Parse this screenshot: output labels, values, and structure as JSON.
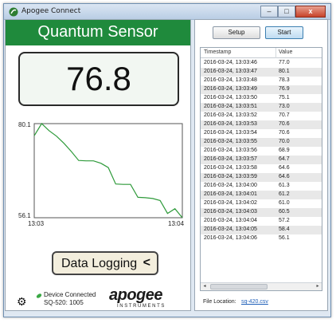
{
  "window": {
    "title": "Apogee Connect",
    "close_glyph": "x",
    "minimize_glyph": "–",
    "maximize_glyph": "□"
  },
  "left": {
    "header_title": "Quantum Sensor",
    "reading": "76.8",
    "data_logging_label": "Data Logging",
    "data_logging_arrow": "<",
    "device_status_line1": "Device Connected",
    "device_status_line2": "SQ-520: 1005",
    "logo_word": "apogee",
    "logo_sub": "INSTRUMENTS",
    "accent_color": "#1f8a3c"
  },
  "chart_data": {
    "type": "line",
    "ytick_labels": [
      "80.1",
      "56.1"
    ],
    "xtick_labels": [
      "13:03",
      "13:04"
    ],
    "ylim": [
      56.1,
      80.1
    ],
    "x": [
      0,
      1,
      2,
      3,
      4,
      5,
      6,
      7,
      8,
      9,
      10,
      11,
      12,
      13,
      14,
      15,
      16,
      17,
      18,
      19,
      20
    ],
    "values": [
      77.0,
      80.1,
      78.3,
      76.9,
      75.1,
      73.0,
      70.7,
      70.6,
      70.6,
      70.0,
      68.9,
      64.7,
      64.6,
      64.6,
      61.3,
      61.2,
      61.0,
      60.5,
      57.2,
      58.4,
      56.1
    ],
    "line_color": "#2e9a3a"
  },
  "right": {
    "setup_label": "Setup",
    "start_label": "Start",
    "columns": [
      "Timestamp",
      "Value"
    ],
    "rows": [
      [
        "2016-03-24, 13:03:46",
        "77.0"
      ],
      [
        "2016-03-24, 13:03:47",
        "80.1"
      ],
      [
        "2016-03-24, 13:03:48",
        "78.3"
      ],
      [
        "2016-03-24, 13:03:49",
        "76.9"
      ],
      [
        "2016-03-24, 13:03:50",
        "75.1"
      ],
      [
        "2016-03-24, 13:03:51",
        "73.0"
      ],
      [
        "2016-03-24, 13:03:52",
        "70.7"
      ],
      [
        "2016-03-24, 13:03:53",
        "70.6"
      ],
      [
        "2016-03-24, 13:03:54",
        "70.6"
      ],
      [
        "2016-03-24, 13:03:55",
        "70.0"
      ],
      [
        "2016-03-24, 13:03:56",
        "68.9"
      ],
      [
        "2016-03-24, 13:03:57",
        "64.7"
      ],
      [
        "2016-03-24, 13:03:58",
        "64.6"
      ],
      [
        "2016-03-24, 13:03:59",
        "64.6"
      ],
      [
        "2016-03-24, 13:04:00",
        "61.3"
      ],
      [
        "2016-03-24, 13:04:01",
        "61.2"
      ],
      [
        "2016-03-24, 13:04:02",
        "61.0"
      ],
      [
        "2016-03-24, 13:04:03",
        "60.5"
      ],
      [
        "2016-03-24, 13:04:04",
        "57.2"
      ],
      [
        "2016-03-24, 13:04:05",
        "58.4"
      ],
      [
        "2016-03-24, 13:04:06",
        "56.1"
      ]
    ],
    "scroll_left_glyph": "◂",
    "scroll_right_glyph": "▸",
    "scroll_thumb_glyph": "≡",
    "file_location_label": "File Location:",
    "file_location_value": "sq-420.csv"
  }
}
